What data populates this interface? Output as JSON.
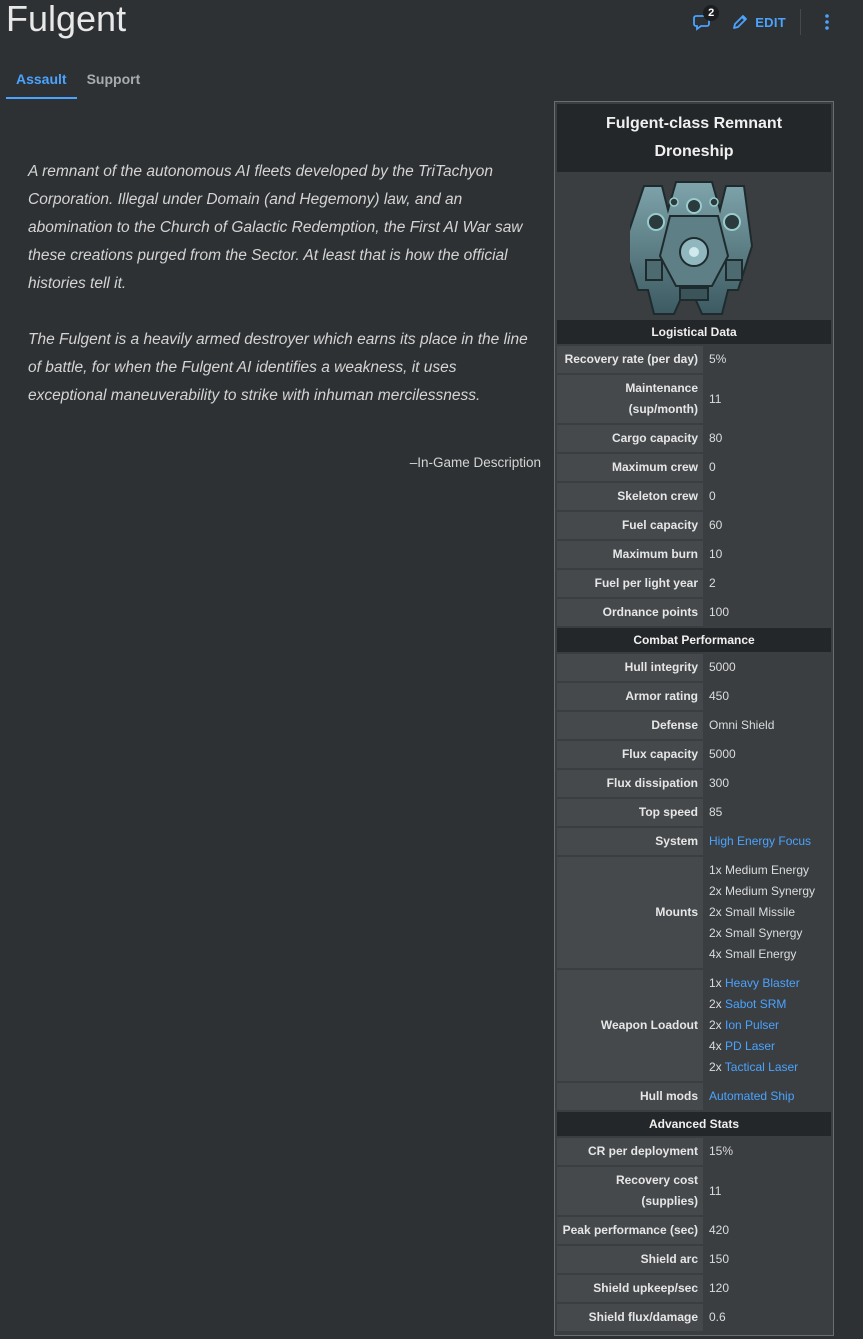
{
  "page": {
    "title": "Fulgent",
    "talk_count": "2",
    "edit_label": "EDIT"
  },
  "tabs": [
    {
      "label": "Assault",
      "active": true
    },
    {
      "label": "Support",
      "active": false
    }
  ],
  "description": {
    "paragraphs": [
      "A remnant of the autonomous AI fleets developed by the TriTachyon Corporation. Illegal under Domain (and Hegemony) law, and an abomination to the Church of Galactic Redemption, the First AI War saw these creations purged from the Sector. At least that is how the official histories tell it.",
      "The Fulgent is a heavily armed destroyer which earns its place in the line of battle, for when the Fulgent AI identifies a weakness, it uses exceptional maneuverability to strike with inhuman mercilessness."
    ],
    "source": "–In-Game Description"
  },
  "infobox": {
    "title": "Fulgent-class Remnant Droneship",
    "colors": {
      "accent": "#4aa3ff",
      "header_bg": "#242729",
      "label_bg": "#45494c"
    },
    "sections": [
      {
        "heading": "Logistical Data",
        "rows": [
          {
            "label": "Recovery rate (per day)",
            "value": "5%"
          },
          {
            "label": "Maintenance (sup/month)",
            "value": "11"
          },
          {
            "label": "Cargo capacity",
            "value": "80"
          },
          {
            "label": "Maximum crew",
            "value": "0"
          },
          {
            "label": "Skeleton crew",
            "value": "0"
          },
          {
            "label": "Fuel capacity",
            "value": "60"
          },
          {
            "label": "Maximum burn",
            "value": "10"
          },
          {
            "label": "Fuel per light year",
            "value": "2"
          },
          {
            "label": "Ordnance points",
            "value": "100"
          }
        ]
      },
      {
        "heading": "Combat Performance",
        "rows": [
          {
            "label": "Hull integrity",
            "value": "5000"
          },
          {
            "label": "Armor rating",
            "value": "450"
          },
          {
            "label": "Defense",
            "value": "Omni Shield"
          },
          {
            "label": "Flux capacity",
            "value": "5000"
          },
          {
            "label": "Flux dissipation",
            "value": "300"
          },
          {
            "label": "Top speed",
            "value": "85"
          },
          {
            "label": "System",
            "value": "High Energy Focus",
            "link": true
          },
          {
            "label": "Mounts",
            "lines": [
              {
                "text": "1x Medium Energy"
              },
              {
                "text": "2x Medium Synergy"
              },
              {
                "text": "2x Small Missile"
              },
              {
                "text": "2x Small Synergy"
              },
              {
                "text": "4x Small Energy"
              }
            ]
          },
          {
            "label": "Weapon Loadout",
            "lines": [
              {
                "prefix": "1x ",
                "link": "Heavy Blaster"
              },
              {
                "prefix": "2x ",
                "link": "Sabot SRM"
              },
              {
                "prefix": "2x ",
                "link": "Ion Pulser"
              },
              {
                "prefix": "4x ",
                "link": "PD Laser"
              },
              {
                "prefix": "2x ",
                "link": "Tactical Laser"
              }
            ]
          },
          {
            "label": "Hull mods",
            "value": "Automated Ship",
            "link": true
          }
        ]
      },
      {
        "heading": "Advanced Stats",
        "rows": [
          {
            "label": "CR per deployment",
            "value": "15%"
          },
          {
            "label": "Recovery cost (supplies)",
            "value": "11"
          },
          {
            "label": "Peak performance (sec)",
            "value": "420"
          },
          {
            "label": "Shield arc",
            "value": "150"
          },
          {
            "label": "Shield upkeep/sec",
            "value": "120"
          },
          {
            "label": "Shield flux/damage",
            "value": "0.6"
          }
        ]
      }
    ]
  },
  "icons": {
    "talk": "speech-bubble-icon",
    "edit": "pencil-icon",
    "more": "kebab-menu-icon",
    "ship": "ship-sprite-image"
  }
}
